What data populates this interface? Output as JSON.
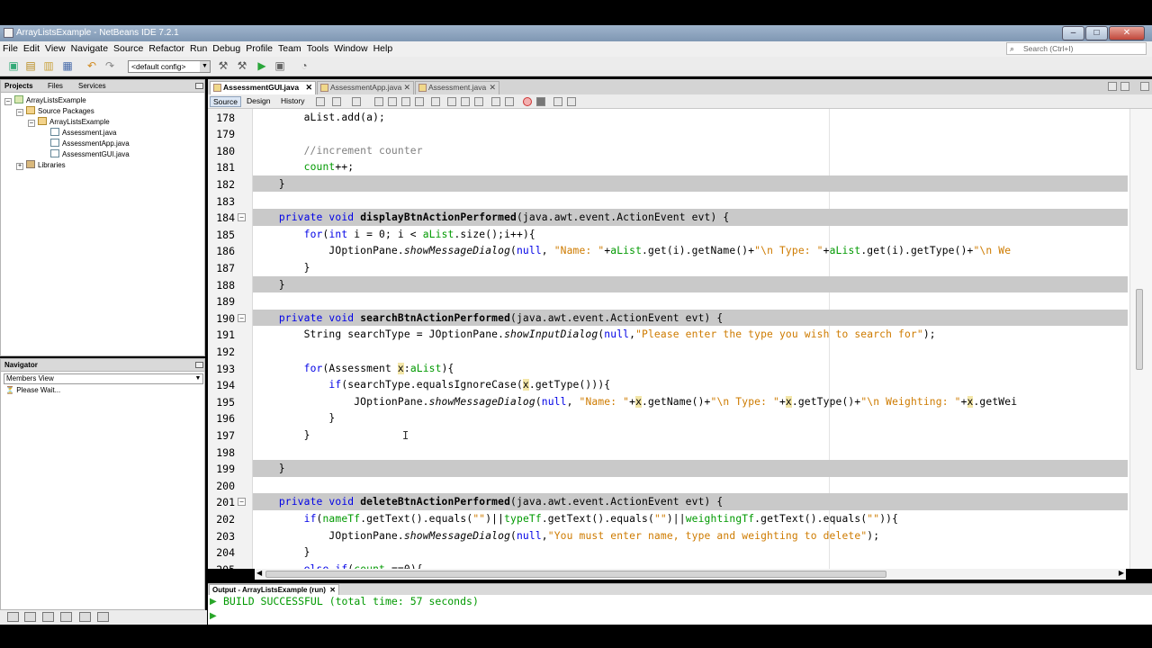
{
  "window": {
    "title": "ArrayListsExample - NetBeans IDE 7.2.1",
    "buttons": {
      "minimize": "–",
      "maximize": "□",
      "close": "✕"
    }
  },
  "menu": [
    "File",
    "Edit",
    "View",
    "Navigate",
    "Source",
    "Refactor",
    "Run",
    "Debug",
    "Profile",
    "Team",
    "Tools",
    "Window",
    "Help"
  ],
  "search": {
    "placeholder": "Search (Ctrl+I)"
  },
  "toolbar": {
    "config": "<default config>"
  },
  "projects": {
    "tabs": [
      "Projects",
      "Files",
      "Services"
    ],
    "tree": [
      {
        "label": "ArrayListsExample"
      },
      {
        "label": "Source Packages"
      },
      {
        "label": "ArrayListsExample"
      },
      {
        "label": "Assessment.java"
      },
      {
        "label": "AssessmentApp.java"
      },
      {
        "label": "AssessmentGUI.java"
      },
      {
        "label": "Libraries"
      }
    ]
  },
  "navigator": {
    "tab": "Navigator",
    "view": "Members View",
    "status": "Please Wait..."
  },
  "editor": {
    "tabs": [
      "AssessmentGUI.java",
      "AssessmentApp.java",
      "Assessment.java"
    ],
    "modes": [
      "Source",
      "Design",
      "History"
    ],
    "lines": [
      {
        "n": "178",
        "parts": [
          {
            "t": "        aList.add(a);",
            "c": "plain"
          }
        ]
      },
      {
        "n": "179",
        "parts": []
      },
      {
        "n": "180",
        "parts": [
          {
            "t": "        //increment counter",
            "c": "cm"
          }
        ]
      },
      {
        "n": "181",
        "parts": [
          {
            "t": "        ",
            "c": "plain"
          },
          {
            "t": "count",
            "c": "fld"
          },
          {
            "t": "++;",
            "c": "plain"
          }
        ]
      },
      {
        "n": "182",
        "parts": [
          {
            "t": "    }",
            "c": "plain"
          }
        ]
      },
      {
        "n": "183",
        "parts": []
      },
      {
        "n": "184",
        "parts": [
          {
            "t": "    ",
            "c": "plain"
          },
          {
            "t": "private void ",
            "c": "kw"
          },
          {
            "t": "displayBtnActionPerformed",
            "c": "bd"
          },
          {
            "t": "(java.awt.event.ActionEvent evt) {",
            "c": "plain"
          }
        ]
      },
      {
        "n": "185",
        "parts": [
          {
            "t": "        ",
            "c": "plain"
          },
          {
            "t": "for",
            "c": "kw"
          },
          {
            "t": "(",
            "c": "plain"
          },
          {
            "t": "int",
            "c": "kw"
          },
          {
            "t": " i = 0; i < ",
            "c": "plain"
          },
          {
            "t": "aList",
            "c": "fld"
          },
          {
            "t": ".size();i++){",
            "c": "plain"
          }
        ]
      },
      {
        "n": "186",
        "parts": [
          {
            "t": "            JOptionPane.",
            "c": "plain"
          },
          {
            "t": "showMessageDialog",
            "c": "it"
          },
          {
            "t": "(",
            "c": "plain"
          },
          {
            "t": "null",
            "c": "kw"
          },
          {
            "t": ", ",
            "c": "plain"
          },
          {
            "t": "\"Name: \"",
            "c": "st"
          },
          {
            "t": "+",
            "c": "plain"
          },
          {
            "t": "aList",
            "c": "fld"
          },
          {
            "t": ".get(i).getName()+",
            "c": "plain"
          },
          {
            "t": "\"\\n Type: \"",
            "c": "st"
          },
          {
            "t": "+",
            "c": "plain"
          },
          {
            "t": "aList",
            "c": "fld"
          },
          {
            "t": ".get(i).getType()+",
            "c": "plain"
          },
          {
            "t": "\"\\n We",
            "c": "st"
          }
        ]
      },
      {
        "n": "187",
        "parts": [
          {
            "t": "        }",
            "c": "plain"
          }
        ]
      },
      {
        "n": "188",
        "parts": [
          {
            "t": "    }",
            "c": "plain"
          }
        ]
      },
      {
        "n": "189",
        "parts": []
      },
      {
        "n": "190",
        "parts": [
          {
            "t": "    ",
            "c": "plain"
          },
          {
            "t": "private void ",
            "c": "kw"
          },
          {
            "t": "searchBtnActionPerformed",
            "c": "bd"
          },
          {
            "t": "(java.awt.event.ActionEvent evt) {",
            "c": "plain"
          }
        ]
      },
      {
        "n": "191",
        "parts": [
          {
            "t": "        String searchType = JOptionPane.",
            "c": "plain"
          },
          {
            "t": "showInputDialog",
            "c": "it"
          },
          {
            "t": "(",
            "c": "plain"
          },
          {
            "t": "null",
            "c": "kw"
          },
          {
            "t": ",",
            "c": "plain"
          },
          {
            "t": "\"Please enter the type you wish to search for\"",
            "c": "st"
          },
          {
            "t": ");",
            "c": "plain"
          }
        ]
      },
      {
        "n": "192",
        "parts": []
      },
      {
        "n": "193",
        "parts": [
          {
            "t": "        ",
            "c": "plain"
          },
          {
            "t": "for",
            "c": "kw"
          },
          {
            "t": "(Assessment ",
            "c": "plain"
          },
          {
            "t": "x",
            "c": "xv"
          },
          {
            "t": ":",
            "c": "plain"
          },
          {
            "t": "aList",
            "c": "fld"
          },
          {
            "t": "){",
            "c": "plain"
          }
        ]
      },
      {
        "n": "194",
        "parts": [
          {
            "t": "            ",
            "c": "plain"
          },
          {
            "t": "if",
            "c": "kw"
          },
          {
            "t": "(searchType.equalsIgnoreCase(",
            "c": "plain"
          },
          {
            "t": "x",
            "c": "xv"
          },
          {
            "t": ".getType())){",
            "c": "plain"
          }
        ]
      },
      {
        "n": "195",
        "parts": [
          {
            "t": "                JOptionPane.",
            "c": "plain"
          },
          {
            "t": "showMessageDialog",
            "c": "it"
          },
          {
            "t": "(",
            "c": "plain"
          },
          {
            "t": "null",
            "c": "kw"
          },
          {
            "t": ", ",
            "c": "plain"
          },
          {
            "t": "\"Name: \"",
            "c": "st"
          },
          {
            "t": "+",
            "c": "plain"
          },
          {
            "t": "x",
            "c": "xv"
          },
          {
            "t": ".getName()+",
            "c": "plain"
          },
          {
            "t": "\"\\n Type: \"",
            "c": "st"
          },
          {
            "t": "+",
            "c": "plain"
          },
          {
            "t": "x",
            "c": "xv"
          },
          {
            "t": ".getType()+",
            "c": "plain"
          },
          {
            "t": "\"\\n Weighting: \"",
            "c": "st"
          },
          {
            "t": "+",
            "c": "plain"
          },
          {
            "t": "x",
            "c": "xv"
          },
          {
            "t": ".getWei",
            "c": "plain"
          }
        ]
      },
      {
        "n": "196",
        "parts": [
          {
            "t": "            }",
            "c": "plain"
          }
        ]
      },
      {
        "n": "197",
        "parts": [
          {
            "t": "        }",
            "c": "plain"
          }
        ]
      },
      {
        "n": "198",
        "parts": []
      },
      {
        "n": "199",
        "parts": [
          {
            "t": "    }",
            "c": "plain"
          }
        ]
      },
      {
        "n": "200",
        "parts": []
      },
      {
        "n": "201",
        "parts": [
          {
            "t": "    ",
            "c": "plain"
          },
          {
            "t": "private void ",
            "c": "kw"
          },
          {
            "t": "deleteBtnActionPerformed",
            "c": "bd"
          },
          {
            "t": "(java.awt.event.ActionEvent evt) {",
            "c": "plain"
          }
        ]
      },
      {
        "n": "202",
        "parts": [
          {
            "t": "        ",
            "c": "plain"
          },
          {
            "t": "if",
            "c": "kw"
          },
          {
            "t": "(",
            "c": "plain"
          },
          {
            "t": "nameTf",
            "c": "fld"
          },
          {
            "t": ".getText().equals(",
            "c": "plain"
          },
          {
            "t": "\"\"",
            "c": "st"
          },
          {
            "t": ")||",
            "c": "plain"
          },
          {
            "t": "typeTf",
            "c": "fld"
          },
          {
            "t": ".getText().equals(",
            "c": "plain"
          },
          {
            "t": "\"\"",
            "c": "st"
          },
          {
            "t": ")||",
            "c": "plain"
          },
          {
            "t": "weightingTf",
            "c": "fld"
          },
          {
            "t": ".getText().equals(",
            "c": "plain"
          },
          {
            "t": "\"\"",
            "c": "st"
          },
          {
            "t": ")){",
            "c": "plain"
          }
        ]
      },
      {
        "n": "203",
        "parts": [
          {
            "t": "            JOptionPane.",
            "c": "plain"
          },
          {
            "t": "showMessageDialog",
            "c": "it"
          },
          {
            "t": "(",
            "c": "plain"
          },
          {
            "t": "null",
            "c": "kw"
          },
          {
            "t": ",",
            "c": "plain"
          },
          {
            "t": "\"You must enter name, type and weighting to delete\"",
            "c": "st"
          },
          {
            "t": ");",
            "c": "plain"
          }
        ]
      },
      {
        "n": "204",
        "parts": [
          {
            "t": "        }",
            "c": "plain"
          }
        ]
      },
      {
        "n": "205",
        "parts": [
          {
            "t": "        ",
            "c": "plain"
          },
          {
            "t": "else if",
            "c": "kw"
          },
          {
            "t": "(",
            "c": "plain"
          },
          {
            "t": "count",
            "c": "fld"
          },
          {
            "t": " ==0){",
            "c": "plain"
          }
        ]
      }
    ]
  },
  "output": {
    "tab": "Output - ArrayListsExample (run)",
    "text": "BUILD SUCCESSFUL (total time: 57 seconds)"
  }
}
